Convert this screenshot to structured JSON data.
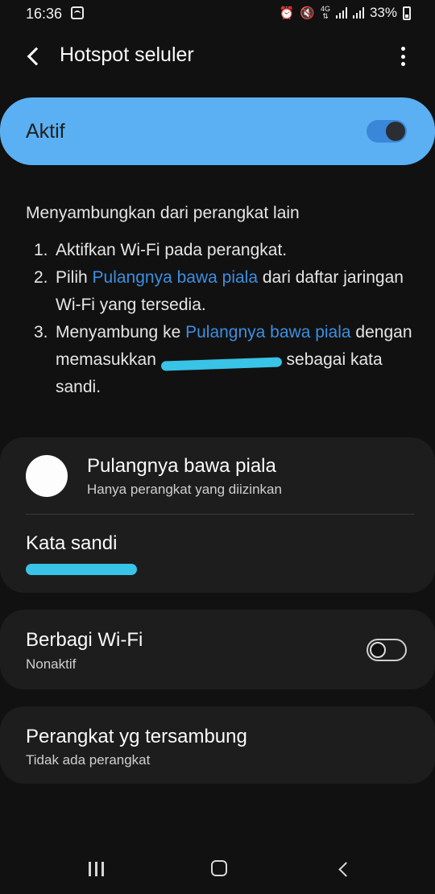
{
  "status_bar": {
    "time": "16:36",
    "network_type": "4G",
    "battery": "33%",
    "icons": [
      "wifi-calling-icon",
      "alarm-icon",
      "mute-icon",
      "network-4g-icon",
      "signal-icon",
      "signal-icon",
      "battery-charging-icon"
    ]
  },
  "app_bar": {
    "title": "Hotspot seluler",
    "back_icon": "back-arrow-icon",
    "more_icon": "more-vert-icon"
  },
  "master_switch": {
    "label": "Aktif",
    "state": "on",
    "accent_color": "#5ab0f3"
  },
  "instructions": {
    "heading": "Menyambungkan dari perangkat lain",
    "steps": [
      {
        "num": "1.",
        "text": "Aktifkan Wi-Fi pada perangkat."
      },
      {
        "num": "2.",
        "before": "Pilih ",
        "link": "Pulangnya bawa piala",
        "after": " dari daftar jaringan Wi-Fi yang tersedia."
      },
      {
        "num": "3.",
        "before": "Menyambung ke ",
        "link": "Pulangnya bawa piala",
        "middle": " dengan memasukkan ",
        "after": " sebagai kata sandi."
      }
    ],
    "link_color": "#3d8fe0"
  },
  "network_card": {
    "name": "Pulangnya bawa piala",
    "subtitle": "Hanya perangkat yang diizinkan",
    "password_label": "Kata sandi"
  },
  "wifi_sharing": {
    "title": "Berbagi Wi-Fi",
    "status": "Nonaktif",
    "state": "off"
  },
  "connected_devices": {
    "title": "Perangkat yg tersambung",
    "status": "Tidak ada perangkat"
  },
  "nav_bar": {
    "recent_icon": "recent-apps-icon",
    "home_icon": "home-icon",
    "back_icon": "back-icon"
  }
}
